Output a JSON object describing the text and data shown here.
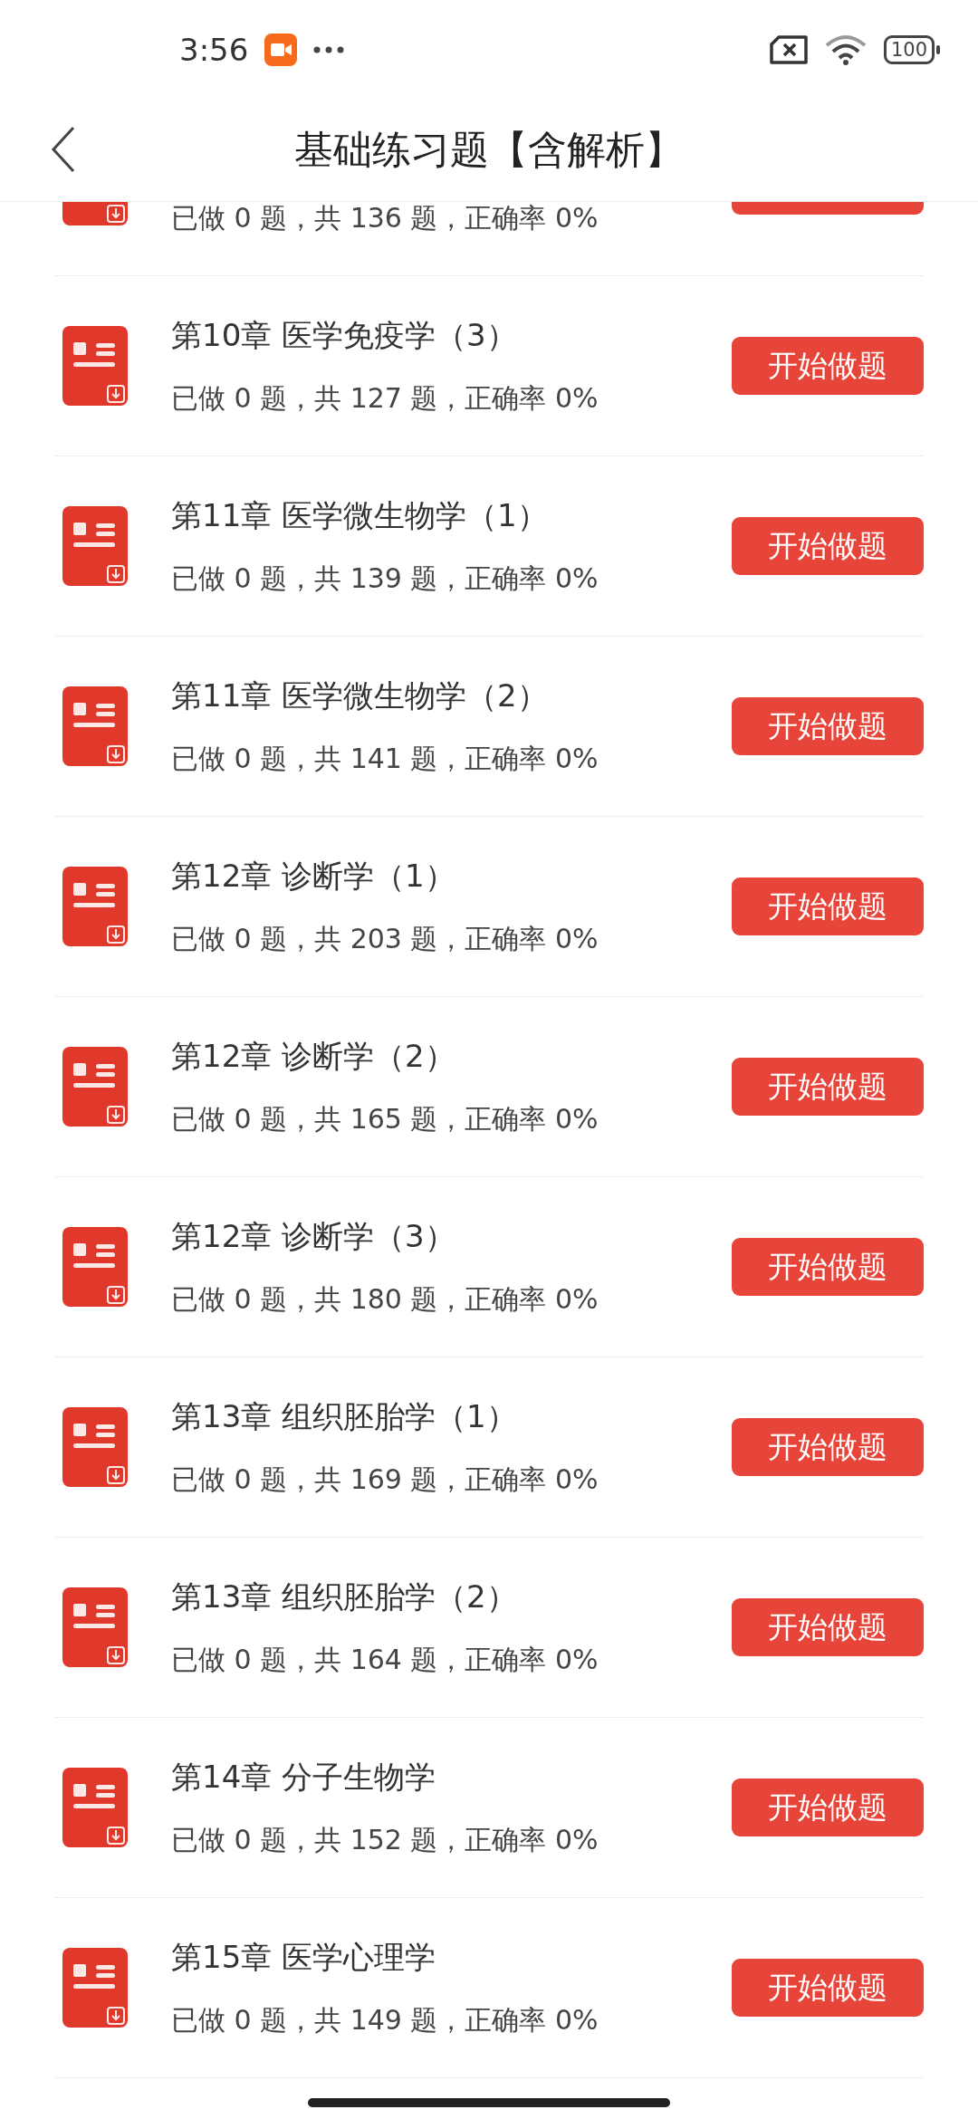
{
  "status_bar": {
    "time": "3:56",
    "battery": "100"
  },
  "header": {
    "title": "基础练习题【含解析】"
  },
  "chapters": [
    {
      "kind": "partial",
      "stats": "已做 0 题，共 136 题，正确率 0%"
    },
    {
      "kind": "full",
      "title": "第10章 医学免疫学（3）",
      "stats": "已做 0 题，共 127 题，正确率 0%",
      "button": "开始做题"
    },
    {
      "kind": "full",
      "title": "第11章 医学微生物学（1）",
      "stats": "已做 0 题，共 139 题，正确率 0%",
      "button": "开始做题"
    },
    {
      "kind": "full",
      "title": "第11章 医学微生物学（2）",
      "stats": "已做 0 题，共 141 题，正确率 0%",
      "button": "开始做题"
    },
    {
      "kind": "full",
      "title": "第12章 诊断学（1）",
      "stats": "已做 0 题，共 203 题，正确率 0%",
      "button": "开始做题"
    },
    {
      "kind": "full",
      "title": "第12章 诊断学（2）",
      "stats": "已做 0 题，共 165 题，正确率 0%",
      "button": "开始做题"
    },
    {
      "kind": "full",
      "title": "第12章 诊断学（3）",
      "stats": "已做 0 题，共 180 题，正确率 0%",
      "button": "开始做题"
    },
    {
      "kind": "full",
      "title": "第13章 组织胚胎学（1）",
      "stats": "已做 0 题，共 169 题，正确率 0%",
      "button": "开始做题"
    },
    {
      "kind": "full",
      "title": "第13章 组织胚胎学（2）",
      "stats": "已做 0 题，共 164 题，正确率 0%",
      "button": "开始做题"
    },
    {
      "kind": "full",
      "title": "第14章 分子生物学",
      "stats": "已做 0 题，共 152 题，正确率 0%",
      "button": "开始做题"
    },
    {
      "kind": "full",
      "title": "第15章 医学心理学",
      "stats": "已做 0 题，共 149 题，正确率 0%",
      "button": "开始做题"
    }
  ]
}
